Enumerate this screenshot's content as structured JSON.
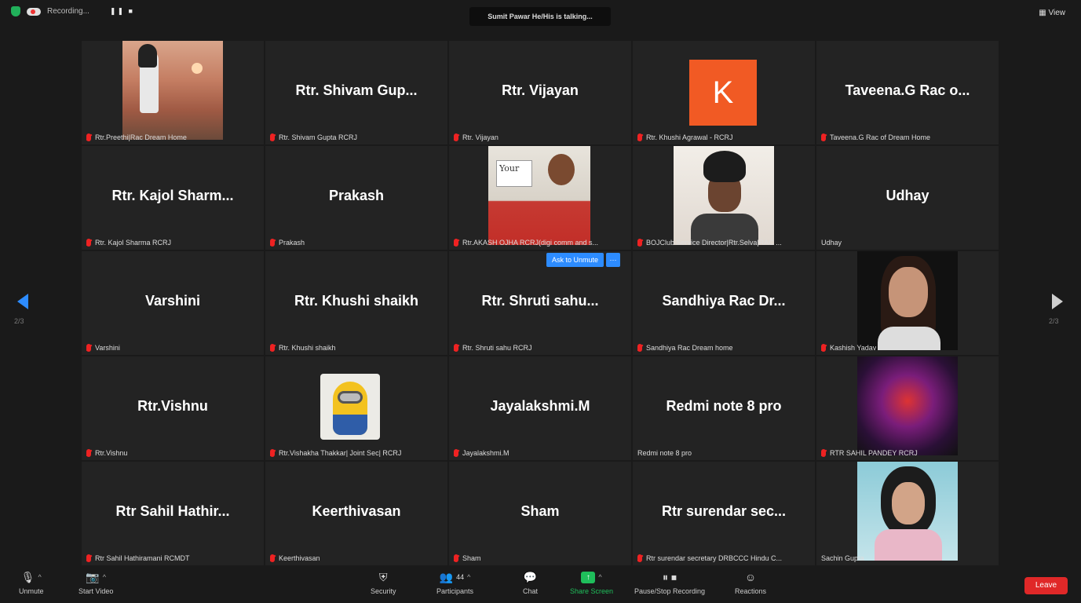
{
  "topbar": {
    "recording_label": "Recording...",
    "recording_controls": "❚❚ ■",
    "talking": "Sumit Pawar He/His is talking...",
    "view_label": "View"
  },
  "tiles": [
    {
      "big": "",
      "name": "Rtr.Preethi|Rac Dream Home",
      "photo": "woman"
    },
    {
      "big": "Rtr. Shivam Gup...",
      "name": "Rtr. Shivam Gupta RCRJ"
    },
    {
      "big": "Rtr. Vijayan",
      "name": "Rtr. Vijayan"
    },
    {
      "big": "",
      "name": "Rtr. Khushi Agrawal - RCRJ",
      "avatar_letter": "K",
      "avatar_color": "#f15a24"
    },
    {
      "big": "Taveena.G Rac o...",
      "name": "Taveena.G Rac of Dream Home"
    },
    {
      "big": "Rtr. Kajol Sharm...",
      "name": "Rtr. Kajol Sharma RCRJ"
    },
    {
      "big": "Prakash",
      "name": "Prakash"
    },
    {
      "big": "",
      "name": "Rtr.AKASH OJHA RCRJ(digi comm and s...",
      "photo": "man1",
      "sign_text": "Your"
    },
    {
      "big": "",
      "name": "BOJClub Service Director|Rtr.Selva|RAC ...",
      "photo": "man2"
    },
    {
      "big": "Udhay",
      "name": "Udhay"
    },
    {
      "big": "Varshini",
      "name": "Varshini"
    },
    {
      "big": "Rtr. Khushi shaikh",
      "name": "Rtr. Khushi shaikh"
    },
    {
      "big": "Rtr. Shruti sahu...",
      "name": "Rtr. Shruti sahu RCRJ"
    },
    {
      "big": "Sandhiya Rac Dr...",
      "name": "Sandhiya Rac Dream home"
    },
    {
      "big": "",
      "name": "Kashish Yadav",
      "photo": "girl1"
    },
    {
      "big": "Rtr.Vishnu",
      "name": "Rtr.Vishnu"
    },
    {
      "big": "",
      "name": "Rtr.Vishakha Thakkar| Joint Sec| RCRJ",
      "photo": "minion"
    },
    {
      "big": "Jayalakshmi.M",
      "name": "Jayalakshmi.M"
    },
    {
      "big": "Redmi note 8 pro",
      "name": "Redmi note 8 pro"
    },
    {
      "big": "",
      "name": "RTR SAHIL PANDEY RCRJ",
      "photo": "god"
    },
    {
      "big": "Rtr Sahil Hathir...",
      "name": "Rtr Sahil Hathiramani RCMDT"
    },
    {
      "big": "Keerthivasan",
      "name": "Keerthivasan"
    },
    {
      "big": "Sham",
      "name": "Sham"
    },
    {
      "big": "Rtr surendar sec...",
      "name": "Rtr surendar secretary DRBCCC Hindu C..."
    },
    {
      "big": "",
      "name": "Sachin Gupta",
      "photo": "girl2"
    }
  ],
  "ask_to_unmute": "Ask to Unmute",
  "more": "···",
  "pager_left": "2/3",
  "pager_right": "2/3",
  "toolbar": {
    "unmute": "Unmute",
    "start_video": "Start Video",
    "security": "Security",
    "participants": "Participants",
    "participants_count": "44",
    "chat": "Chat",
    "share_screen": "Share Screen",
    "pause_stop_recording": "Pause/Stop Recording",
    "reactions": "Reactions",
    "leave": "Leave"
  },
  "colors": {
    "accent": "#2d8cff",
    "share": "#1fbe5b",
    "leave": "#e02828",
    "mute": "#e22222"
  }
}
